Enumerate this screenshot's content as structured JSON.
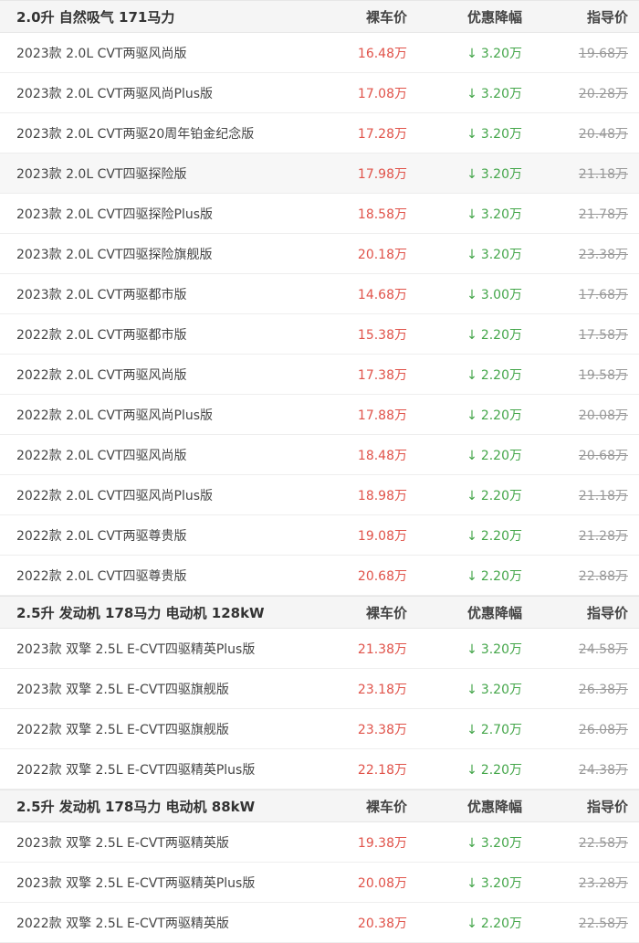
{
  "groups": [
    {
      "title": "2.0升 自然吸气 171马力",
      "col_bare": "裸车价",
      "col_discount": "优惠降幅",
      "col_guide": "指导价",
      "rows": [
        {
          "name": "2023款 2.0L CVT两驱风尚版",
          "bare": "16.48万",
          "discount": "3.20万",
          "guide": "19.68万"
        },
        {
          "name": "2023款 2.0L CVT两驱风尚Plus版",
          "bare": "17.08万",
          "discount": "3.20万",
          "guide": "20.28万"
        },
        {
          "name": "2023款 2.0L CVT两驱20周年铂金纪念版",
          "bare": "17.28万",
          "discount": "3.20万",
          "guide": "20.48万"
        },
        {
          "name": "2023款 2.0L CVT四驱探险版",
          "bare": "17.98万",
          "discount": "3.20万",
          "guide": "21.18万"
        },
        {
          "name": "2023款 2.0L CVT四驱探险Plus版",
          "bare": "18.58万",
          "discount": "3.20万",
          "guide": "21.78万"
        },
        {
          "name": "2023款 2.0L CVT四驱探险旗舰版",
          "bare": "20.18万",
          "discount": "3.20万",
          "guide": "23.38万"
        },
        {
          "name": "2023款 2.0L CVT两驱都市版",
          "bare": "14.68万",
          "discount": "3.00万",
          "guide": "17.68万"
        },
        {
          "name": "2022款 2.0L CVT两驱都市版",
          "bare": "15.38万",
          "discount": "2.20万",
          "guide": "17.58万"
        },
        {
          "name": "2022款 2.0L CVT两驱风尚版",
          "bare": "17.38万",
          "discount": "2.20万",
          "guide": "19.58万"
        },
        {
          "name": "2022款 2.0L CVT两驱风尚Plus版",
          "bare": "17.88万",
          "discount": "2.20万",
          "guide": "20.08万"
        },
        {
          "name": "2022款 2.0L CVT四驱风尚版",
          "bare": "18.48万",
          "discount": "2.20万",
          "guide": "20.68万"
        },
        {
          "name": "2022款 2.0L CVT四驱风尚Plus版",
          "bare": "18.98万",
          "discount": "2.20万",
          "guide": "21.18万"
        },
        {
          "name": "2022款 2.0L CVT两驱尊贵版",
          "bare": "19.08万",
          "discount": "2.20万",
          "guide": "21.28万"
        },
        {
          "name": "2022款 2.0L CVT四驱尊贵版",
          "bare": "20.68万",
          "discount": "2.20万",
          "guide": "22.88万"
        }
      ]
    },
    {
      "title": "2.5升 发动机 178马力 电动机 128kW",
      "col_bare": "裸车价",
      "col_discount": "优惠降幅",
      "col_guide": "指导价",
      "rows": [
        {
          "name": "2023款 双擎 2.5L E-CVT四驱精英Plus版",
          "bare": "21.38万",
          "discount": "3.20万",
          "guide": "24.58万"
        },
        {
          "name": "2023款 双擎 2.5L E-CVT四驱旗舰版",
          "bare": "23.18万",
          "discount": "3.20万",
          "guide": "26.38万"
        },
        {
          "name": "2022款 双擎 2.5L E-CVT四驱旗舰版",
          "bare": "23.38万",
          "discount": "2.70万",
          "guide": "26.08万"
        },
        {
          "name": "2022款 双擎 2.5L E-CVT四驱精英Plus版",
          "bare": "22.18万",
          "discount": "2.20万",
          "guide": "24.38万"
        }
      ]
    },
    {
      "title": "2.5升 发动机 178马力 电动机 88kW",
      "col_bare": "裸车价",
      "col_discount": "优惠降幅",
      "col_guide": "指导价",
      "rows": [
        {
          "name": "2023款 双擎 2.5L E-CVT两驱精英版",
          "bare": "19.38万",
          "discount": "3.20万",
          "guide": "22.58万"
        },
        {
          "name": "2023款 双擎 2.5L E-CVT两驱精英Plus版",
          "bare": "20.08万",
          "discount": "3.20万",
          "guide": "23.28万"
        },
        {
          "name": "2022款 双擎 2.5L E-CVT两驱精英版",
          "bare": "20.38万",
          "discount": "2.20万",
          "guide": "22.58万"
        }
      ]
    }
  ],
  "icons": {
    "discount_arrow": "arrow-down-icon",
    "discount_arrow_glyph": "↓"
  },
  "colors": {
    "bare_price": "#e0534a",
    "discount": "#44a64a",
    "guide_price": "#999999",
    "header_bg": "#f5f5f5"
  }
}
